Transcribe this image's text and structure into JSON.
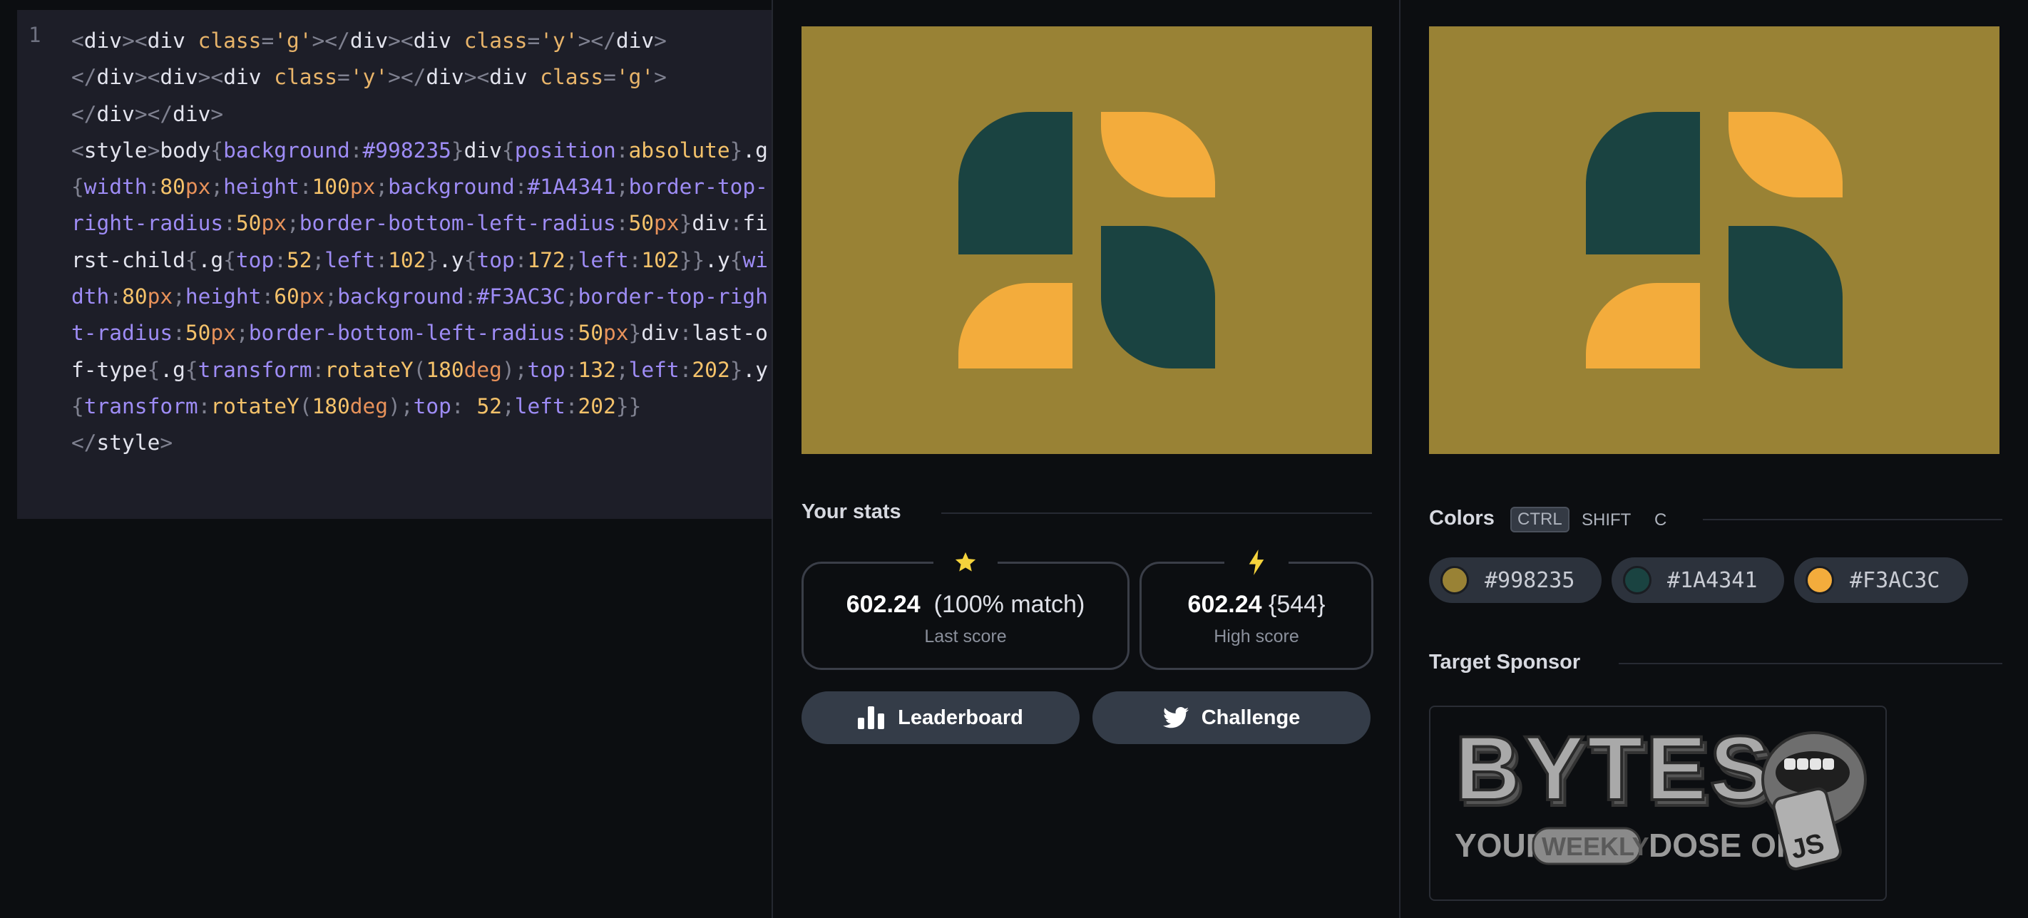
{
  "editor": {
    "line_number": "1"
  },
  "stats": {
    "title": "Your stats",
    "last_score_value": "602.24",
    "last_score_match": "(100% match)",
    "last_score_label": "Last score",
    "high_score_value": "602.24",
    "high_score_extra": "{544}",
    "high_score_label": "High score",
    "leaderboard_label": "Leaderboard",
    "challenge_label": "Challenge"
  },
  "colors": {
    "title": "Colors",
    "shortcut": [
      "CTRL",
      "SHIFT",
      "C"
    ],
    "swatches": [
      {
        "hex": "#998235"
      },
      {
        "hex": "#1A4341"
      },
      {
        "hex": "#F3AC3C"
      }
    ]
  },
  "sponsor": {
    "title": "Target Sponsor",
    "logo_text": "BYTES",
    "tagline_1": "YOUR",
    "tagline_2": "WEEKLY",
    "tagline_3": "DOSE OF",
    "badge": "JS"
  },
  "icons": {
    "last_score": "star-icon",
    "high_score": "lightning-icon",
    "leaderboard": "bar-chart-icon",
    "challenge": "twitter-icon"
  },
  "palette": {
    "background": "#998235",
    "green": "#1A4341",
    "yellow": "#F3AC3C",
    "accent_star": "#f5d33c"
  }
}
